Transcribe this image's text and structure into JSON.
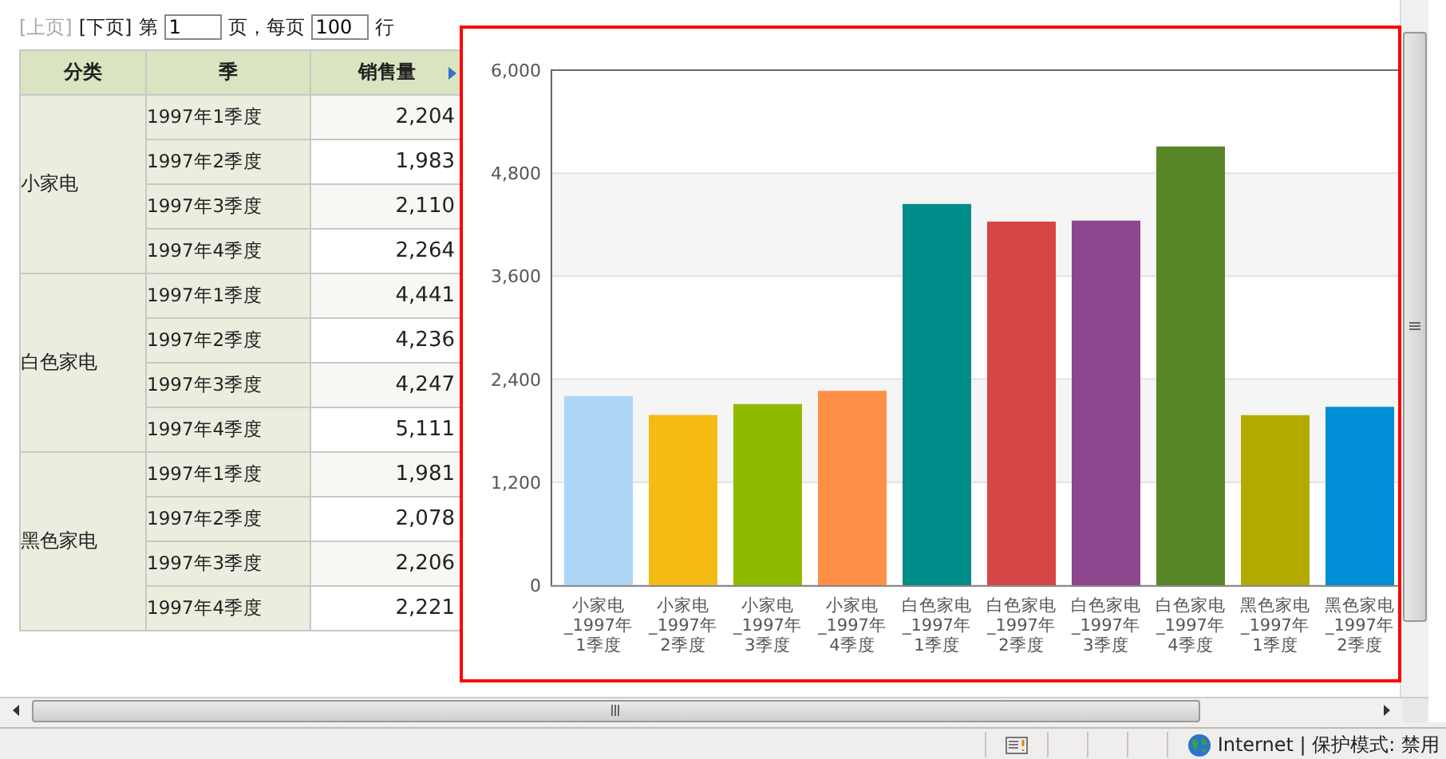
{
  "pager": {
    "prev": {
      "label": "[上页]",
      "disabled": true
    },
    "next": {
      "label": "[下页]",
      "disabled": false
    },
    "page_label": "第",
    "page": "1",
    "per_page_label": "页，每页",
    "per_page": "100",
    "rows_label": "行"
  },
  "table": {
    "columns": [
      {
        "label": "分类"
      },
      {
        "label": "季"
      },
      {
        "label": "销售量"
      }
    ],
    "groups": [
      {
        "name": "小家电",
        "rows": [
          {
            "quarter": "1997年1季度",
            "sales": "2,204"
          },
          {
            "quarter": "1997年2季度",
            "sales": "1,983"
          },
          {
            "quarter": "1997年3季度",
            "sales": "2,110"
          },
          {
            "quarter": "1997年4季度",
            "sales": "2,264"
          }
        ]
      },
      {
        "name": "白色家电",
        "rows": [
          {
            "quarter": "1997年1季度",
            "sales": "4,441"
          },
          {
            "quarter": "1997年2季度",
            "sales": "4,236"
          },
          {
            "quarter": "1997年3季度",
            "sales": "4,247"
          },
          {
            "quarter": "1997年4季度",
            "sales": "5,111"
          }
        ]
      },
      {
        "name": "黑色家电",
        "rows": [
          {
            "quarter": "1997年1季度",
            "sales": "1,981"
          },
          {
            "quarter": "1997年2季度",
            "sales": "2,078"
          },
          {
            "quarter": "1997年3季度",
            "sales": "2,206"
          },
          {
            "quarter": "1997年4季度",
            "sales": "2,221"
          }
        ]
      }
    ]
  },
  "chart": {
    "bars": [
      {
        "color": "#acd5f6"
      },
      {
        "color": "#f4bb12"
      },
      {
        "color": "#8fba00"
      },
      {
        "color": "#fe8f46"
      },
      {
        "color": "#008d8a"
      },
      {
        "color": "#d64646"
      },
      {
        "color": "#8e468e"
      },
      {
        "color": "#588526"
      },
      {
        "color": "#b3aa00"
      },
      {
        "color": "#008ed6"
      }
    ],
    "chart_data": {
      "type": "bar",
      "categories": [
        "小家电\n_1997年\n1季度",
        "小家电\n_1997年\n2季度",
        "小家电\n_1997年\n3季度",
        "小家电\n_1997年\n4季度",
        "白色家电\n_1997年\n1季度",
        "白色家电\n_1997年\n2季度",
        "白色家电\n_1997年\n3季度",
        "白色家电\n_1997年\n4季度",
        "黑色家电\n_1997年\n1季度",
        "黑色家电\n_1997年\n2季度"
      ],
      "series": [
        {
          "values": [
            2204,
            1983,
            2110,
            2264,
            4441,
            4236,
            4247,
            5111,
            1981,
            2078
          ]
        }
      ],
      "ylim": [
        0,
        6000
      ],
      "grid": true,
      "yticks": [
        {
          "value": 0,
          "label": "0"
        },
        {
          "value": 1200,
          "label": "1,200"
        },
        {
          "value": 2400,
          "label": "2,400"
        },
        {
          "value": 3600,
          "label": "3,600"
        },
        {
          "value": 4800,
          "label": "4,800"
        },
        {
          "value": 6000,
          "label": "6,000"
        }
      ]
    }
  },
  "status_bar": {
    "zone": "Internet | 保护模式: 禁用"
  }
}
